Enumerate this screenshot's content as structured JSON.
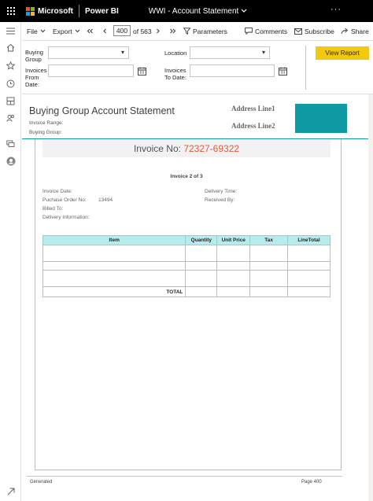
{
  "topbar": {
    "brand": "Microsoft",
    "product": "Power BI",
    "report_title": "WWI - Account Statement",
    "more": "···"
  },
  "toolbar": {
    "file": "File",
    "export": "Export",
    "current_page": "400",
    "page_total": "of 563",
    "parameters": "Parameters",
    "comments": "Comments",
    "subscribe": "Subscribe",
    "share": "Share"
  },
  "params": {
    "buying_group_label": "Buying Group",
    "location_label": "Location",
    "invoices_from_label": "Invoices From Date:",
    "invoices_to_label": "Invoices To Date:",
    "view_report": "View Report"
  },
  "report": {
    "title": "Buying Group Account Statement",
    "invoice_range_label": "Invoice Range:",
    "buying_group_label": "Buying Group:",
    "address_line1": "Address Line1",
    "address_line2": "Address Line2",
    "invoice_no_label": "Invoice No:",
    "invoice_no": "72327-69322",
    "invoice_page": "Invoice 2 of 3",
    "fields_left": [
      "Invoice Date:",
      "Puchase Order No:",
      "Billed To:",
      "Delivery Information:"
    ],
    "po_number": "13494",
    "fields_right": [
      "Delivery Time:",
      "Received By:"
    ],
    "table_headers": [
      "Item",
      "Quantity",
      "Unit Price",
      "Tax",
      "LineTotal"
    ],
    "total_label": "TOTAL",
    "footer_left": "Generated",
    "footer_right": "Page 400"
  },
  "colors": {
    "topbar_bg": "#000000",
    "accent_yellow": "#f2c811",
    "teal": "#0f9aa3",
    "invoice_number": "#e05a3e",
    "table_header": "#b8ebed"
  }
}
